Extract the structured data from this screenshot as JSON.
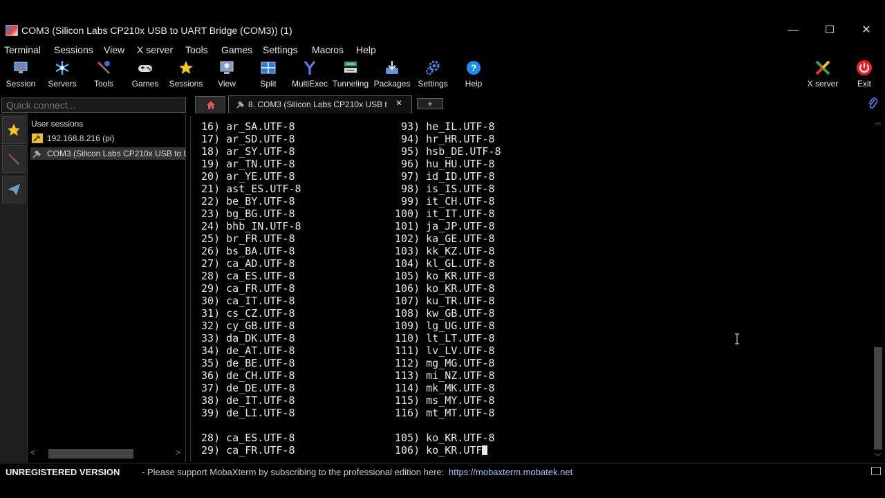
{
  "window": {
    "title": "COM3  (Silicon Labs CP210x USB to UART Bridge (COM3)) (1)",
    "minimize": "—",
    "maximize": "☐",
    "close": "✕"
  },
  "menu": [
    "Terminal",
    "Sessions",
    "View",
    "X server",
    "Tools",
    "Games",
    "Settings",
    "Macros",
    "Help"
  ],
  "toolbar": {
    "left": [
      {
        "label": "Session",
        "icon": "monitor-icon"
      },
      {
        "label": "Servers",
        "icon": "servers-icon"
      },
      {
        "label": "Tools",
        "icon": "tools-icon"
      },
      {
        "label": "Games",
        "icon": "gamepad-icon"
      },
      {
        "label": "Sessions",
        "icon": "star-icon"
      },
      {
        "label": "View",
        "icon": "view-icon"
      },
      {
        "label": "Split",
        "icon": "split-icon"
      },
      {
        "label": "MultiExec",
        "icon": "multiexec-icon"
      },
      {
        "label": "Tunneling",
        "icon": "tunneling-icon"
      },
      {
        "label": "Packages",
        "icon": "packages-icon"
      },
      {
        "label": "Settings",
        "icon": "gear-icon"
      },
      {
        "label": "Help",
        "icon": "help-icon"
      }
    ],
    "right": [
      {
        "label": "X server",
        "icon": "x-server-icon"
      },
      {
        "label": "Exit",
        "icon": "power-icon"
      }
    ]
  },
  "quick_connect": {
    "placeholder": "Quick connect..."
  },
  "tabs": {
    "active_label": "8. COM3  (Silicon Labs CP210x USB t",
    "close": "✕",
    "add": "+"
  },
  "sessions_panel": {
    "header": "User sessions",
    "items": [
      {
        "label": "192.168.8.216 (pi)",
        "icon": "ssh-key-icon",
        "selected": false
      },
      {
        "label": "COM3  (Silicon Labs CP210x USB to UA",
        "icon": "serial-plug-icon",
        "selected": true
      }
    ],
    "scroll_left": "<",
    "scroll_right": ">"
  },
  "terminal": {
    "lines": [
      " 16) ar_SA.UTF-8                 93) he_IL.UTF-8",
      " 17) ar_SD.UTF-8                 94) hr_HR.UTF-8",
      " 18) ar_SY.UTF-8                 95) hsb_DE.UTF-8",
      " 19) ar_TN.UTF-8                 96) hu_HU.UTF-8",
      " 20) ar_YE.UTF-8                 97) id_ID.UTF-8",
      " 21) ast_ES.UTF-8                98) is_IS.UTF-8",
      " 22) be_BY.UTF-8                 99) it_CH.UTF-8",
      " 23) bg_BG.UTF-8                100) it_IT.UTF-8",
      " 24) bhb_IN.UTF-8               101) ja_JP.UTF-8",
      " 25) br_FR.UTF-8                102) ka_GE.UTF-8",
      " 26) bs_BA.UTF-8                103) kk_KZ.UTF-8",
      " 27) ca_AD.UTF-8                104) kl_GL.UTF-8",
      " 28) ca_ES.UTF-8                105) ko_KR.UTF-8",
      " 29) ca_FR.UTF-8                106) ko_KR.UTF-8",
      " 30) ca_IT.UTF-8                107) ku_TR.UTF-8",
      " 31) cs_CZ.UTF-8                108) kw_GB.UTF-8",
      " 32) cy_GB.UTF-8                109) lg_UG.UTF-8",
      " 33) da_DK.UTF-8                110) lt_LT.UTF-8",
      " 34) de_AT.UTF-8                111) lv_LV.UTF-8",
      " 35) de_BE.UTF-8                112) mg_MG.UTF-8",
      " 36) de_CH.UTF-8                113) mi_NZ.UTF-8",
      " 37) de_DE.UTF-8                114) mk_MK.UTF-8",
      " 38) de_IT.UTF-8                115) ms_MY.UTF-8",
      " 39) de_LI.UTF-8                116) mt_MT.UTF-8",
      "",
      " 28) ca_ES.UTF-8                105) ko_KR.UTF-8",
      " 29) ca_FR.UTF-8                106) ko_KR.UTF"
    ]
  },
  "statusbar": {
    "edition": "UNREGISTERED VERSION",
    "message": "-  Please support MobaXterm by subscribing to the professional edition here:",
    "link": "https://mobaxterm.mobatek.net"
  }
}
